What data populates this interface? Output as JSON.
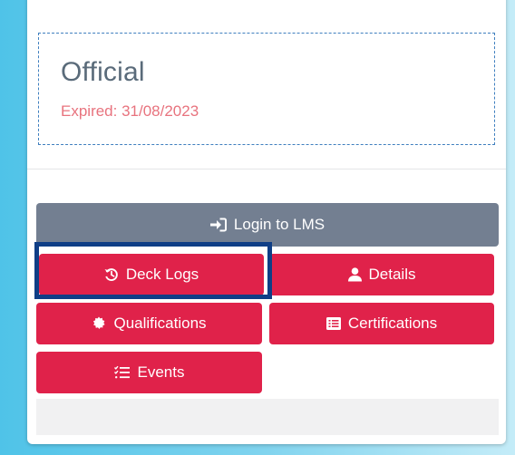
{
  "membership": {
    "title": "Official",
    "status": "Expired: 31/08/2023"
  },
  "actions": {
    "login_lms": {
      "label": "Login to LMS",
      "icon": "sign-in-icon"
    },
    "deck_logs": {
      "label": "Deck Logs",
      "icon": "history-icon"
    },
    "details": {
      "label": "Details",
      "icon": "user-icon"
    },
    "qualifications": {
      "label": "Qualifications",
      "icon": "certificate-icon"
    },
    "certifications": {
      "label": "Certifications",
      "icon": "list-alt-icon"
    },
    "events": {
      "label": "Events",
      "icon": "checklist-icon"
    }
  },
  "colors": {
    "accent_red": "#e0224a",
    "lms_gray": "#737f91",
    "dashed_border": "#3f7fbf",
    "expired_text": "#e8737e",
    "highlight_outline": "#0f3e86"
  }
}
